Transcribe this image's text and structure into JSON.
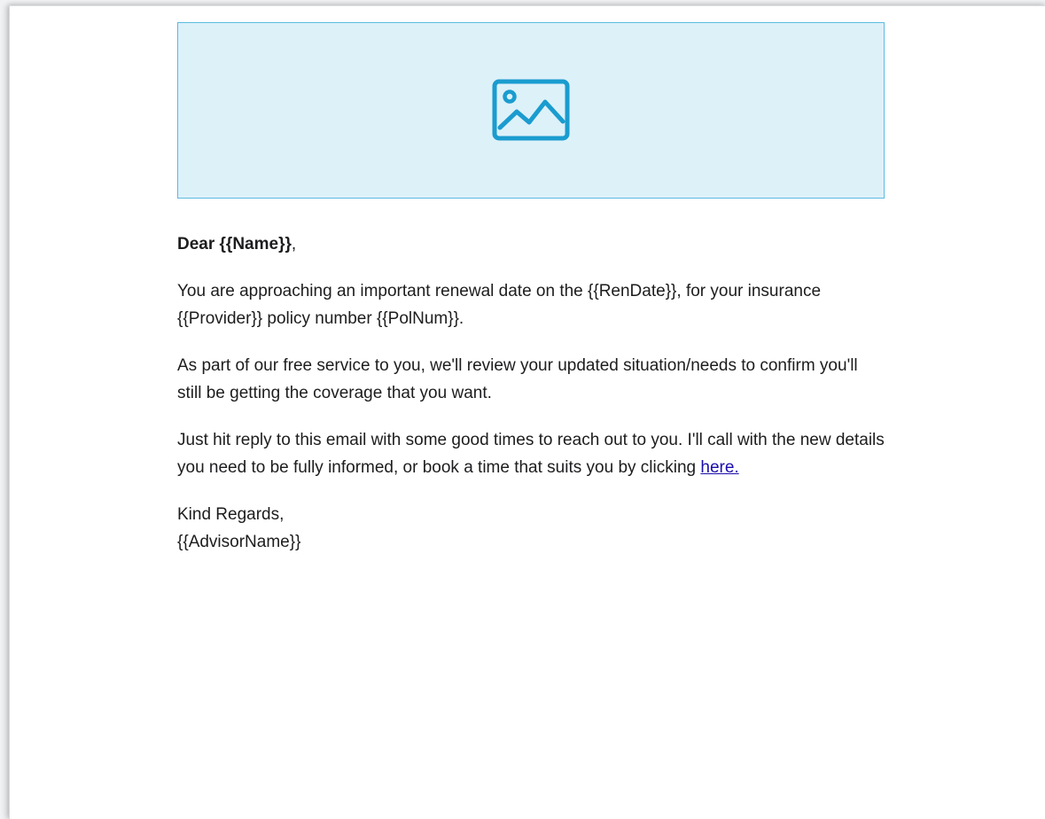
{
  "email": {
    "image_placeholder": {
      "icon": "image-icon",
      "colors": {
        "background": "#ddf1f9",
        "border": "#5bbbe0",
        "icon": "#1a9ccf"
      }
    },
    "greeting": {
      "bold": "Dear {{Name}}",
      "suffix": ","
    },
    "paragraphs": {
      "renewal": "You are approaching an important renewal date on the {{RenDate}}, for your insurance {{Provider}} policy number {{PolNum}}.",
      "service": "As part of our free service to you, we'll review your updated situation/needs to confirm you'll still be getting the coverage that you want.",
      "reply_text": "Just hit reply to this email with some good times to reach out to you. I'll call with the new details you need to be fully informed, or book a time that suits you by clicking ",
      "reply_link": "here."
    },
    "signoff": {
      "closing": "Kind Regards,",
      "advisor": "{{AdvisorName}}"
    },
    "link_color": "#1a0dab"
  }
}
